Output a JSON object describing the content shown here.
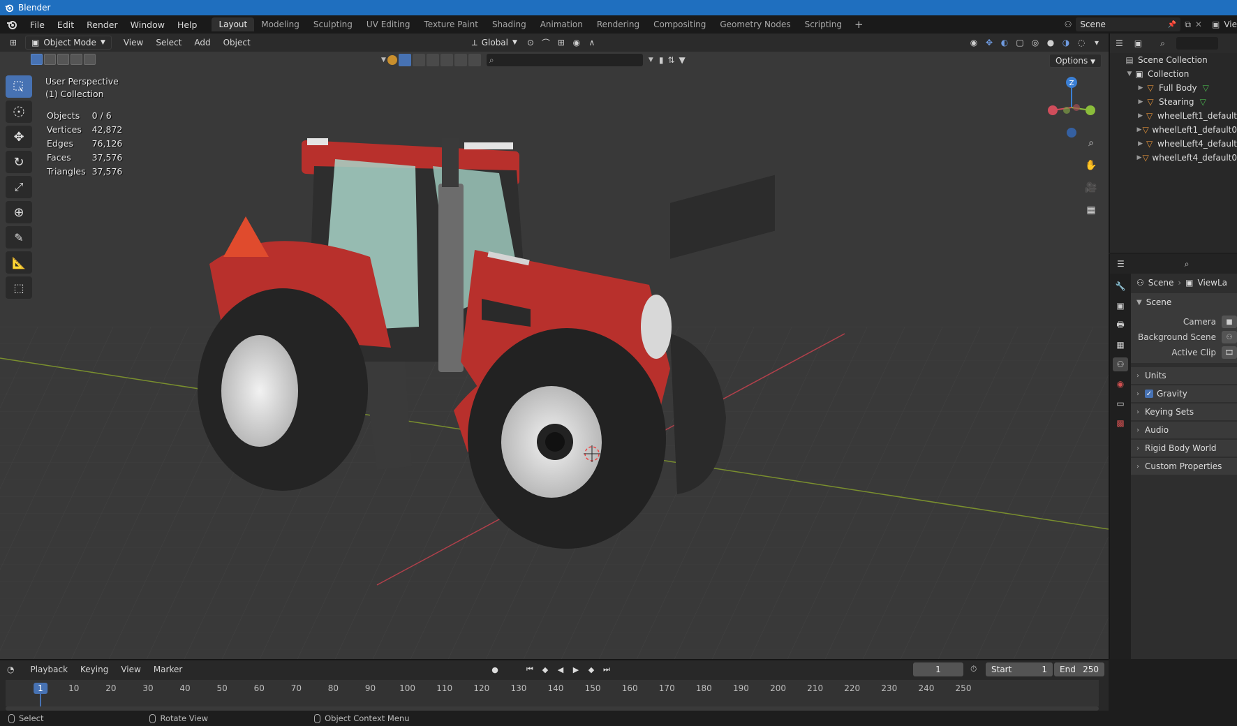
{
  "window": {
    "title": "Blender"
  },
  "menu": [
    "File",
    "Edit",
    "Render",
    "Window",
    "Help"
  ],
  "workspaces": {
    "active": "Layout",
    "tabs": [
      "Layout",
      "Modeling",
      "Sculpting",
      "UV Editing",
      "Texture Paint",
      "Shading",
      "Animation",
      "Rendering",
      "Compositing",
      "Geometry Nodes",
      "Scripting"
    ]
  },
  "scene_selector": {
    "value": "Scene",
    "view_layer_cut": "Vie"
  },
  "viewport": {
    "mode": "Object Mode",
    "menus": [
      "View",
      "Select",
      "Add",
      "Object"
    ],
    "transform_orientation": "Global",
    "options_label": "Options",
    "view_name": "User Perspective",
    "collection_label": "(1) Collection",
    "stats": [
      {
        "label": "Objects",
        "value": "0 / 6"
      },
      {
        "label": "Vertices",
        "value": "42,872"
      },
      {
        "label": "Edges",
        "value": "76,126"
      },
      {
        "label": "Faces",
        "value": "37,576"
      },
      {
        "label": "Triangles",
        "value": "37,576"
      }
    ],
    "gizmo_axis_label": "Z",
    "colors": {
      "x_axis": "#d04d5b",
      "y_axis": "#8bbd3b",
      "z_axis": "#3b7fd4",
      "tractor_red": "#b8302c"
    }
  },
  "outliner": {
    "root": "Scene Collection",
    "collection": "Collection",
    "items": [
      "Full Body",
      "Stearing",
      "wheelLeft1_default",
      "wheelLeft1_default0",
      "wheelLeft4_default",
      "wheelLeft4_default0"
    ]
  },
  "properties": {
    "breadcrumb": {
      "scene": "Scene",
      "view_layer": "ViewLa"
    },
    "panel_title": "Scene",
    "rows": [
      "Camera",
      "Background Scene",
      "Active Clip"
    ],
    "subpanels": [
      "Units",
      "Gravity",
      "Keying Sets",
      "Audio",
      "Rigid Body World",
      "Custom Properties"
    ]
  },
  "timeline": {
    "menus": [
      "Playback",
      "Keying",
      "View",
      "Marker"
    ],
    "current_frame": "1",
    "start_label": "Start",
    "start_value": "1",
    "end_label": "End",
    "end_value": "250",
    "ticks": [
      "10",
      "20",
      "30",
      "40",
      "50",
      "60",
      "70",
      "80",
      "90",
      "100",
      "110",
      "120",
      "130",
      "140",
      "150",
      "160",
      "170",
      "180",
      "190",
      "200",
      "210",
      "220",
      "230",
      "240",
      "250"
    ]
  },
  "statusbar": {
    "select": "Select",
    "rotate": "Rotate View",
    "context": "Object Context Menu"
  }
}
